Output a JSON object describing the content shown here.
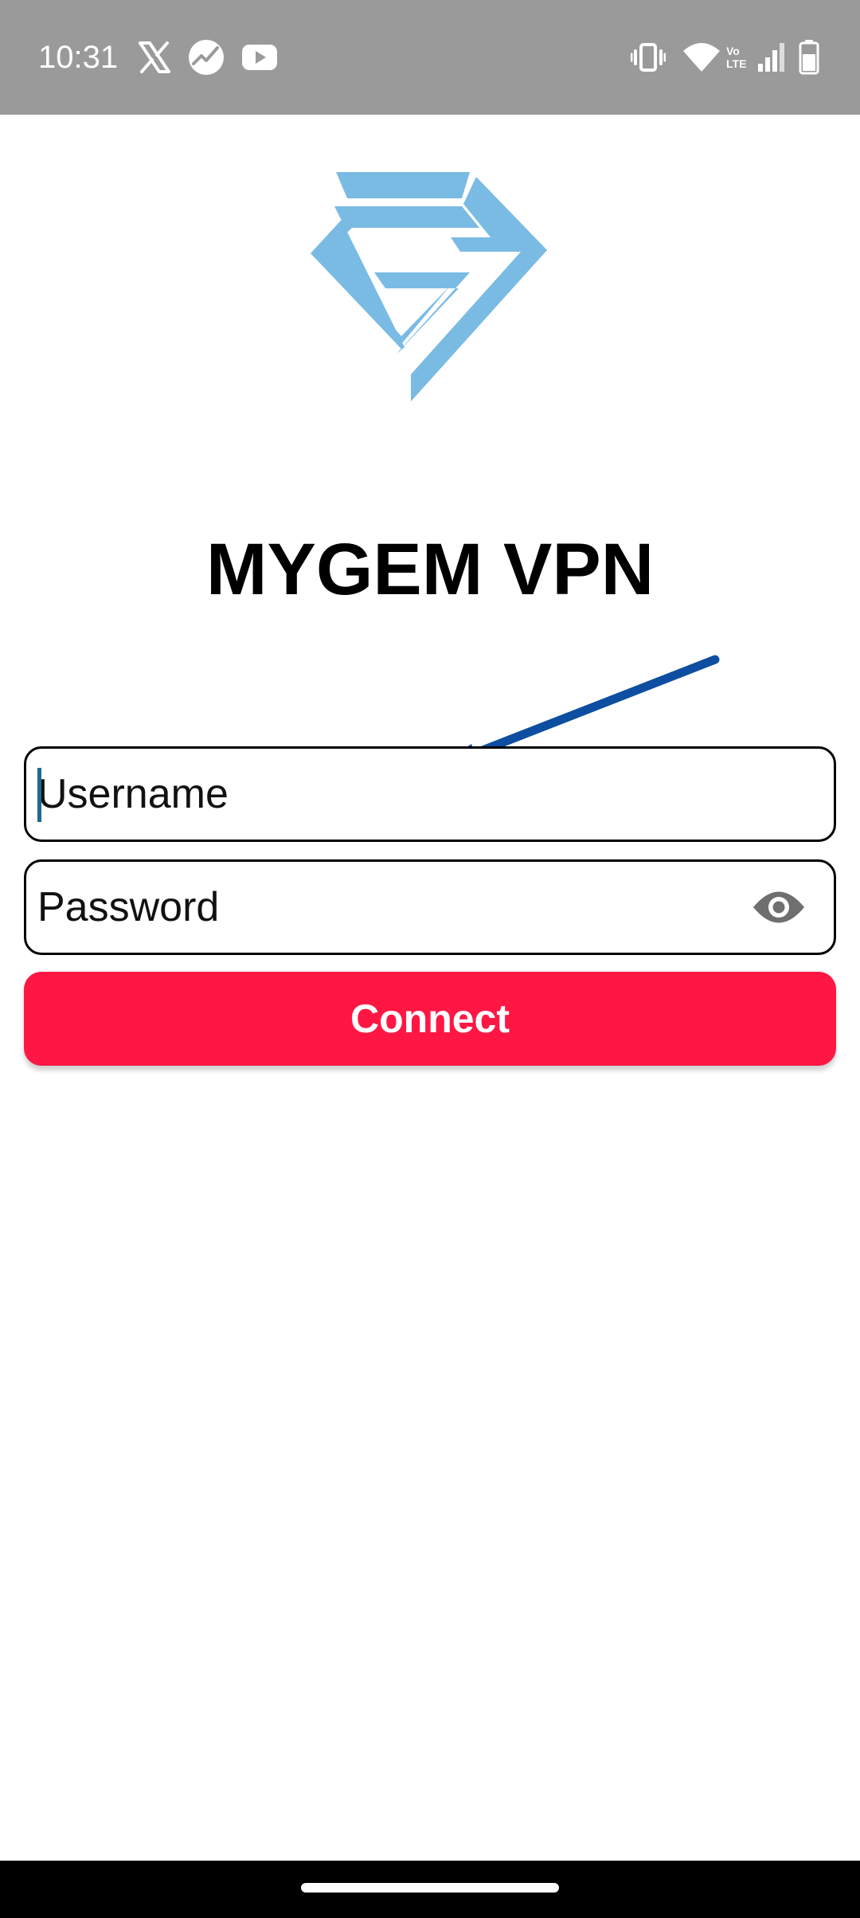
{
  "status_bar": {
    "time": "10:31",
    "left_icons": [
      "x-app-icon",
      "analytics-icon",
      "youtube-icon"
    ],
    "right_icons": [
      "vibrate-icon",
      "wifi-icon",
      "volte-icon",
      "signal-icon",
      "battery-icon"
    ],
    "volte_text": "Vo LTE"
  },
  "app": {
    "title": "MYGEM VPN",
    "logo_icon": "gem-logo-icon",
    "logo_color": "#7abbe4"
  },
  "form": {
    "username_placeholder": "Username",
    "password_placeholder": "Password",
    "password_toggle_icon": "eye-icon",
    "connect_label": "Connect"
  },
  "colors": {
    "accent": "#ff1744",
    "annotation_arrow": "#0d4ea1",
    "status_bar_bg": "#9a9a9a"
  }
}
